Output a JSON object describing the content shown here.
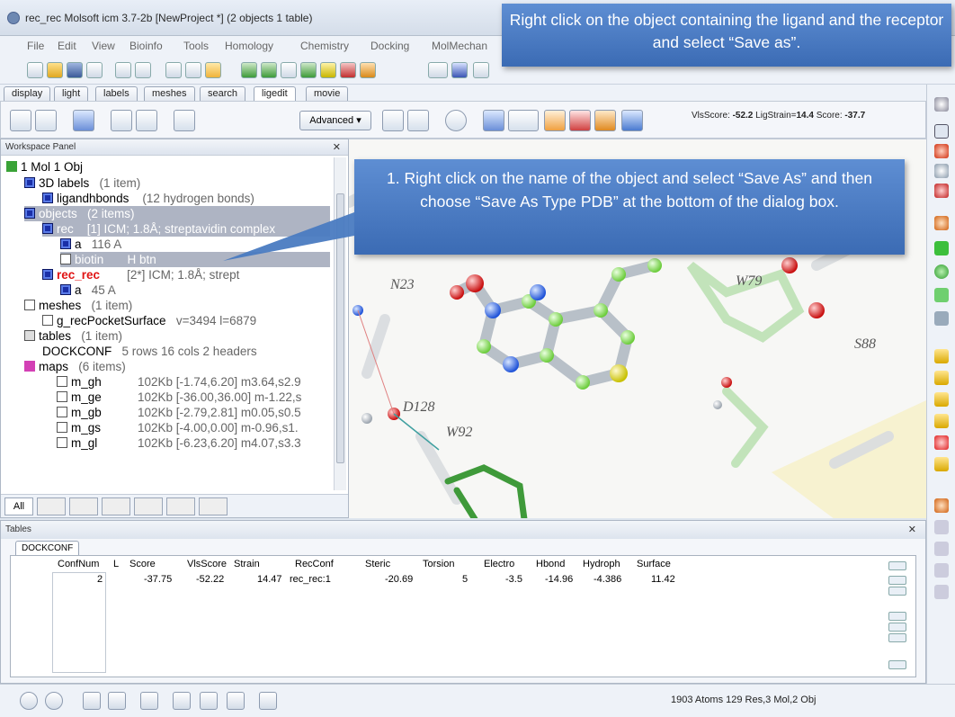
{
  "window": {
    "title": "rec_rec Molsoft icm 3.7-2b  [NewProject *] (2 objects 1 table)"
  },
  "menu": [
    "File",
    "Edit",
    "View",
    "Bioinfo",
    "Tools",
    "Homology",
    "Chemistry",
    "Docking",
    "MolMechan"
  ],
  "tabs": [
    "display",
    "light",
    "labels",
    "meshes",
    "search",
    "ligedit",
    "movie"
  ],
  "active_tab": "ligedit",
  "toolbar2": {
    "advanced_label": "Advanced",
    "vis_score_label": "VlsScore:",
    "vis_score_value": "-52.2",
    "lig_strain_label": "LigStrain=",
    "lig_strain_value": "14.4",
    "score_label": "Score:",
    "score_value": "-37.7"
  },
  "workspace": {
    "title": "Workspace Panel",
    "controls": "ð ✕",
    "tree": [
      {
        "label": "1 Mol 1 Obj",
        "detail": ""
      },
      {
        "label": "3D labels",
        "detail": "(1 item)"
      },
      {
        "label": "ligandhbonds",
        "detail": "(12 hydrogen bonds)"
      },
      {
        "label": "objects",
        "detail": "(2 items)"
      },
      {
        "label": "rec",
        "detail": "[1] ICM; 1.8Å; streptavidin complex"
      },
      {
        "label": "a",
        "detail": "116 A"
      },
      {
        "label": "biotin",
        "detail": "H  btn"
      },
      {
        "label": "rec_rec",
        "detail": "[2*] ICM; 1.8Å; strept"
      },
      {
        "label": "a",
        "detail": "45 A"
      },
      {
        "label": "meshes",
        "detail": "(1 item)"
      },
      {
        "label": "g_recPocketSurface",
        "detail": "v=3494 l=6879"
      },
      {
        "label": "tables",
        "detail": "(1 item)"
      },
      {
        "label": "DOCKCONF",
        "detail": "5 rows 16 cols 2 headers"
      },
      {
        "label": "maps",
        "detail": "(6 items)"
      },
      {
        "label": "m_gh",
        "detail": "102Kb [-1.74,6.20] m3.64,s2.9"
      },
      {
        "label": "m_ge",
        "detail": "102Kb [-36.00,36.00] m-1.22,s"
      },
      {
        "label": "m_gb",
        "detail": "102Kb [-2.79,2.81] m0.05,s0.5"
      },
      {
        "label": "m_gs",
        "detail": "102Kb [-4.00,0.00] m-0.96,s1."
      },
      {
        "label": "m_gl",
        "detail": "102Kb [-6.23,6.20] m4.07,s3.3"
      }
    ],
    "bottom_tab_all": "All"
  },
  "viewer_labels": [
    "N23",
    "W79",
    "S88",
    "D128",
    "W92"
  ],
  "tables_panel": {
    "title": "Tables",
    "tab": "DOCKCONF",
    "columns": [
      "ConfNum",
      "L",
      "Score",
      "VlsScore",
      "Strain",
      "RecConf",
      "Steric",
      "Torsion",
      "Electro",
      "Hbond",
      "Hydroph",
      "Surface"
    ],
    "row": [
      "2",
      "",
      "-37.75",
      "-52.22",
      "14.47",
      "rec_rec:1",
      "-20.69",
      "5",
      "-3.5",
      "-14.96",
      "-4.386",
      "11.42"
    ]
  },
  "status": {
    "text": "1903 Atoms 129 Res,3 Mol,2 Obj"
  },
  "callouts": {
    "top": "Right click on the object containing the ligand and the receptor and select “Save as”.",
    "middle": "1. Right click on the name of the object and select “Save As” and then choose “Save As Type PDB” at the bottom of the dialog box."
  },
  "colors": {
    "callout_blue": "#4a7bc1",
    "selection_gray": "#aeb4c3",
    "object_red": "#e01414"
  }
}
